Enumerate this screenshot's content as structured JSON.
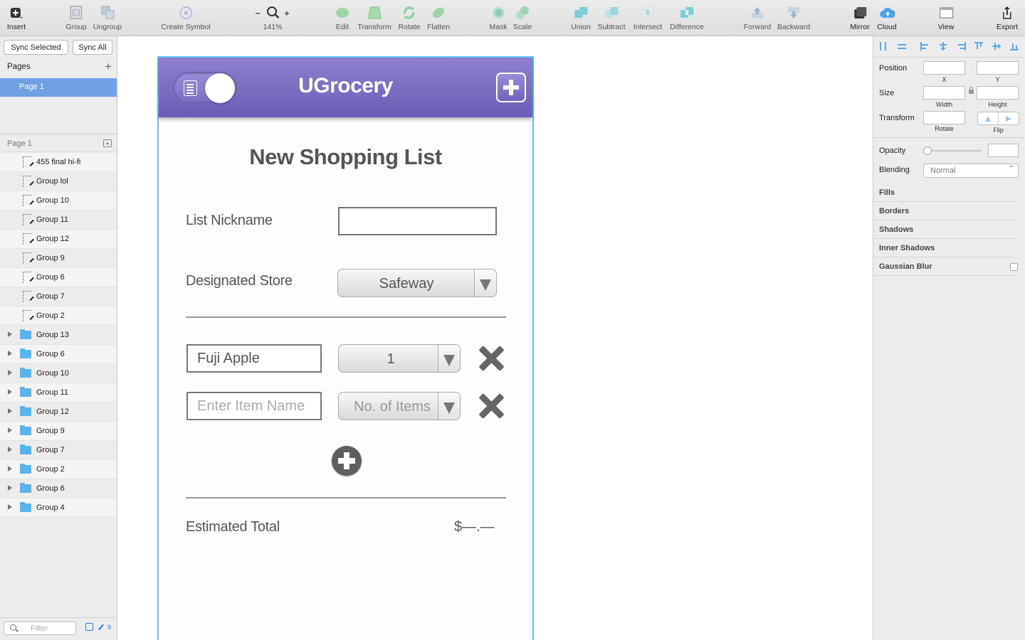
{
  "toolbar": {
    "insert": "Insert",
    "group": "Group",
    "ungroup": "Ungroup",
    "create_symbol": "Create Symbol",
    "zoom": "141%",
    "edit": "Edit",
    "transform": "Transform",
    "rotate": "Rotate",
    "flatten": "Flatten",
    "mask": "Mask",
    "scale": "Scale",
    "union": "Union",
    "subtract": "Subtract",
    "intersect": "Intersect",
    "difference": "Difference",
    "forward": "Forward",
    "backward": "Backward",
    "mirror": "Mirror",
    "cloud": "Cloud",
    "view": "View",
    "export": "Export"
  },
  "sidebar": {
    "sync_selected": "Sync Selected",
    "sync_all": "Sync All",
    "pages_title": "Pages",
    "pages": [
      {
        "label": "Page 1"
      }
    ],
    "layers_title": "Page 1",
    "layers": [
      {
        "label": "455 final hi-fi",
        "kind": "artboard"
      },
      {
        "label": "Group lol",
        "kind": "artboard"
      },
      {
        "label": "Group 10",
        "kind": "artboard"
      },
      {
        "label": "Group 11",
        "kind": "artboard"
      },
      {
        "label": "Group 12",
        "kind": "artboard"
      },
      {
        "label": "Group 9",
        "kind": "artboard"
      },
      {
        "label": "Group 6",
        "kind": "artboard"
      },
      {
        "label": "Group 7",
        "kind": "artboard"
      },
      {
        "label": "Group 2",
        "kind": "artboard"
      },
      {
        "label": "Group 13",
        "kind": "group"
      },
      {
        "label": "Group 6",
        "kind": "group"
      },
      {
        "label": "Group 10",
        "kind": "group"
      },
      {
        "label": "Group 11",
        "kind": "group"
      },
      {
        "label": "Group 12",
        "kind": "group"
      },
      {
        "label": "Group 9",
        "kind": "group"
      },
      {
        "label": "Group 7",
        "kind": "group"
      },
      {
        "label": "Group 2",
        "kind": "group"
      },
      {
        "label": "Group 6",
        "kind": "group"
      },
      {
        "label": "Group 4",
        "kind": "group"
      }
    ],
    "filter_placeholder": "Filter",
    "filter_count": "9"
  },
  "app": {
    "title": "UGrocery",
    "form_title": "New Shopping List",
    "list_nickname_label": "List Nickname",
    "list_nickname_value": "",
    "store_label": "Designated Store",
    "store_value": "Safeway",
    "items": [
      {
        "name": "Fuji Apple",
        "qty": "1"
      }
    ],
    "item_name_placeholder": "Enter Item Name",
    "item_qty_placeholder": "No. of Items",
    "total_label": "Estimated Total",
    "total_value": "$—.—"
  },
  "inspector": {
    "position": "Position",
    "x": "X",
    "y": "Y",
    "size": "Size",
    "width": "Width",
    "height": "Height",
    "transform": "Transform",
    "rotate": "Rotate",
    "flip": "Flip",
    "opacity": "Opacity",
    "blending": "Blending",
    "blending_value": "Normal",
    "fills": "Fills",
    "borders": "Borders",
    "shadows": "Shadows",
    "inner_shadows": "Inner Shadows",
    "gaussian_blur": "Gaussian Blur"
  },
  "colors": {
    "header_gradient_top": "#8f7fd0",
    "header_gradient_bottom": "#6a5bb8",
    "artboard_border": "#66c2f2",
    "selection_blue": "#6fa1e6"
  }
}
